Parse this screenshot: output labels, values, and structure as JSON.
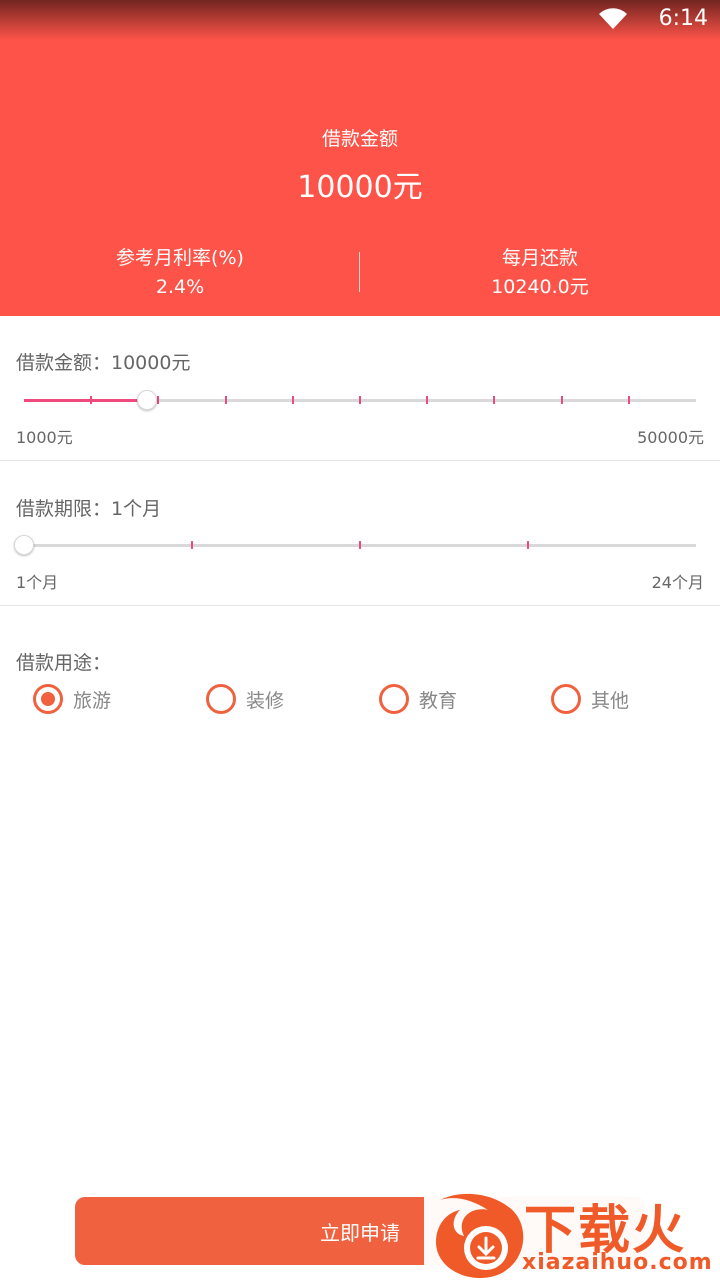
{
  "status_bar": {
    "time": "6:14",
    "wifi_icon": "wifi-icon"
  },
  "header": {
    "amount_label": "借款金额",
    "amount_value": "10000元",
    "rate_label": "参考月利率(%)",
    "rate_value": "2.4%",
    "monthly_label": "每月还款",
    "monthly_value": "10240.0元"
  },
  "loan_amount": {
    "title": "借款金额：10000元",
    "min_label": "1000元",
    "max_label": "50000元",
    "min": 1000,
    "max": 50000,
    "value": 10000,
    "tick_count": 10
  },
  "loan_term": {
    "title": "借款期限：1个月",
    "min_label": "1个月",
    "max_label": "24个月",
    "min": 1,
    "max": 24,
    "value": 1,
    "tick_count": 4
  },
  "purpose": {
    "title": "借款用途：",
    "options": [
      {
        "label": "旅游",
        "checked": true
      },
      {
        "label": "装修",
        "checked": false
      },
      {
        "label": "教育",
        "checked": false
      },
      {
        "label": "其他",
        "checked": false
      }
    ]
  },
  "apply_button": {
    "label": "立即申请"
  },
  "watermark": {
    "text": "下载火",
    "sub": "xiazaihuo.com"
  },
  "colors": {
    "header_bg": "#fd5348",
    "accent": "#f0623f",
    "slider_fill": "#ee4a7b"
  }
}
